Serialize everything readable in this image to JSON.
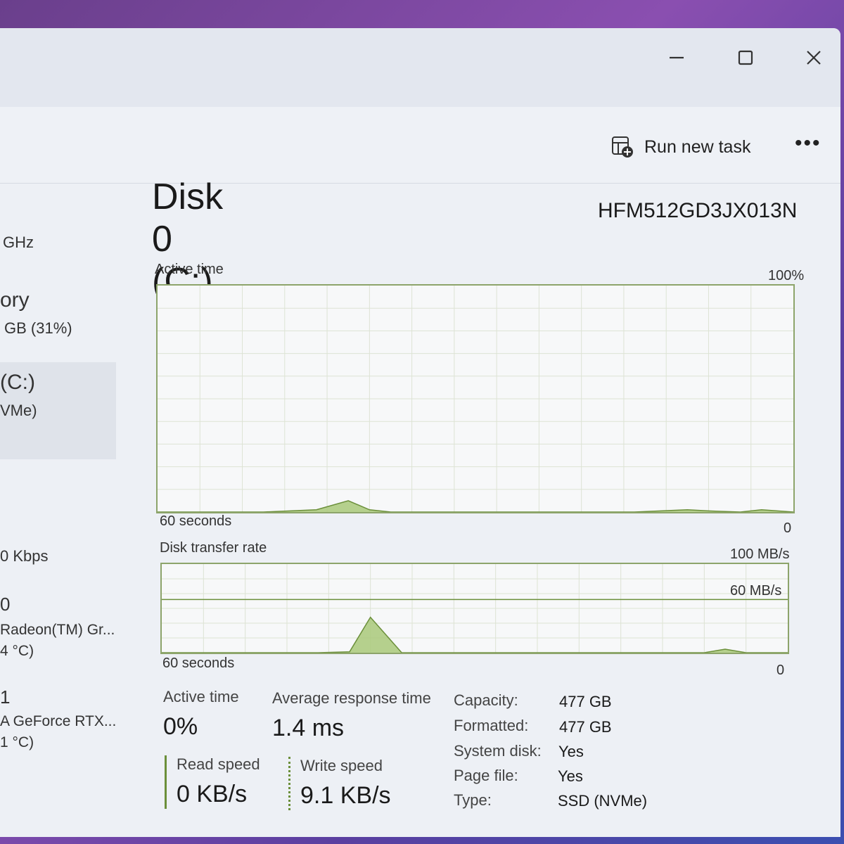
{
  "toolbar": {
    "run_new_task": "Run new task",
    "more": "•••"
  },
  "sidebar": {
    "items": [
      {
        "line1": "GHz"
      },
      {
        "line1": "ory",
        "line2": "GB (31%)"
      },
      {
        "line1": "(C:)",
        "line2": "VMe)",
        "selected": true
      },
      {
        "line1": "0 Kbps"
      },
      {
        "line1": "0",
        "line2": "Radeon(TM) Gr...",
        "line3": "4 °C)"
      },
      {
        "line1": "1",
        "line2": "A GeForce RTX...",
        "line3": "1 °C)"
      }
    ]
  },
  "main": {
    "title": "Disk 0 (C:)",
    "model": "HFM512GD3JX013N",
    "active_chart": {
      "label": "Active time",
      "max": "100%",
      "left": "60 seconds",
      "right": "0"
    },
    "transfer_chart": {
      "label": "Disk transfer rate",
      "max": "100 MB/s",
      "mid": "60 MB/s",
      "left": "60 seconds",
      "right": "0"
    },
    "stats": {
      "active_time_label": "Active time",
      "active_time_value": "0%",
      "avg_response_label": "Average response time",
      "avg_response_value": "1.4 ms",
      "read_label": "Read speed",
      "read_value": "0 KB/s",
      "write_label": "Write speed",
      "write_value": "9.1 KB/s"
    },
    "info": [
      {
        "k": "Capacity:",
        "v": "477 GB"
      },
      {
        "k": "Formatted:",
        "v": "477 GB"
      },
      {
        "k": "System disk:",
        "v": "Yes"
      },
      {
        "k": "Page file:",
        "v": "Yes"
      },
      {
        "k": "Type:",
        "v": "SSD (NVMe)"
      }
    ]
  },
  "chart_data": [
    {
      "type": "area",
      "title": "Active time",
      "xlabel": "60 seconds",
      "ylim": [
        0,
        100
      ],
      "unit": "%",
      "x": [
        60,
        55,
        50,
        45,
        42,
        40,
        38,
        35,
        30,
        25,
        20,
        15,
        10,
        8,
        5,
        3,
        0
      ],
      "values": [
        0,
        0,
        0,
        1,
        5,
        1,
        0,
        0,
        0,
        0,
        0,
        0,
        1,
        0.5,
        0,
        1,
        0
      ]
    },
    {
      "type": "area",
      "title": "Disk transfer rate",
      "xlabel": "60 seconds",
      "ylim": [
        0,
        100
      ],
      "unit": "MB/s",
      "x": [
        60,
        50,
        45,
        42,
        40,
        37,
        30,
        20,
        8,
        6,
        4,
        0
      ],
      "values": [
        0,
        0,
        0,
        1,
        40,
        0,
        0,
        0,
        0,
        4,
        0,
        0
      ]
    }
  ],
  "colors": {
    "accent": "#8da46b",
    "fill": "#a9c97a",
    "line": "#6b8f3a"
  }
}
